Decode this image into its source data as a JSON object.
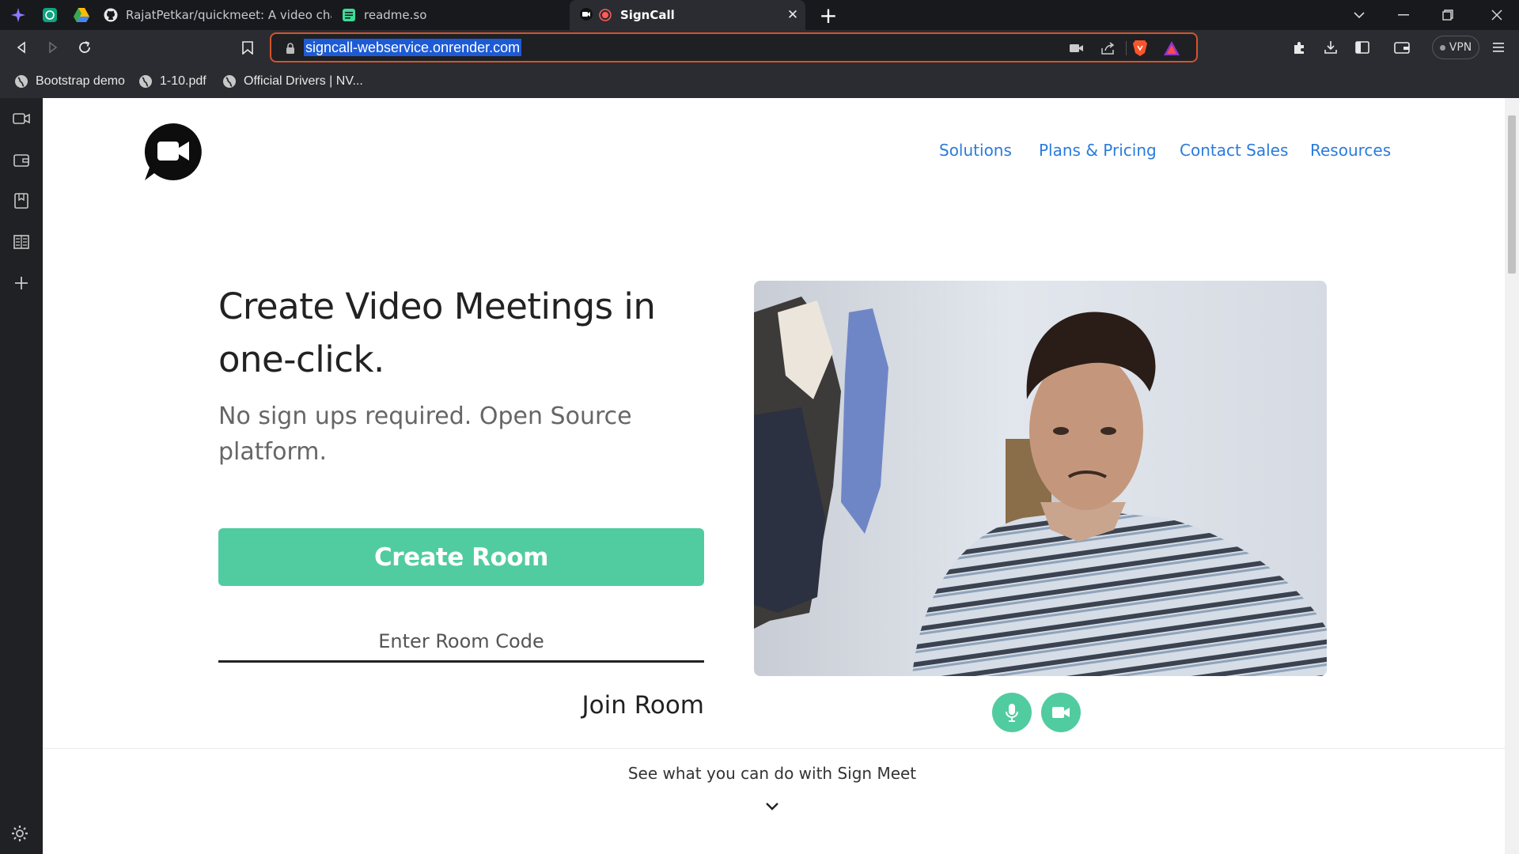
{
  "browser": {
    "tabs": [
      {
        "title": "RajatPetkar/quickmeet: A video chat/m",
        "icon": "github-icon"
      },
      {
        "title": "readme.so",
        "icon": "readme-icon"
      },
      {
        "title": "SignCall",
        "icon": "signcall-icon",
        "active": true
      }
    ],
    "url": "signcall-webservice.onrender.com",
    "vpn_label": "VPN",
    "bookmarks": [
      {
        "label": "Bootstrap demo"
      },
      {
        "label": "1-10.pdf"
      },
      {
        "label": "Official Drivers | NV..."
      }
    ],
    "accent": "#d2542c"
  },
  "page": {
    "nav": {
      "solutions": "Solutions",
      "pricing": "Plans & Pricing",
      "contact": "Contact Sales",
      "resources": "Resources"
    },
    "hero": {
      "title": "Create Video Meetings in one-click.",
      "subtitle": "No sign ups required. Open Source platform."
    },
    "create_room_label": "Create Room",
    "room_code_placeholder": "Enter Room Code",
    "join_room_label": "Join Room",
    "see_what": "See what you can do with Sign Meet",
    "colors": {
      "primary_green": "#50cca0",
      "link_blue": "#2a7bdc"
    }
  }
}
